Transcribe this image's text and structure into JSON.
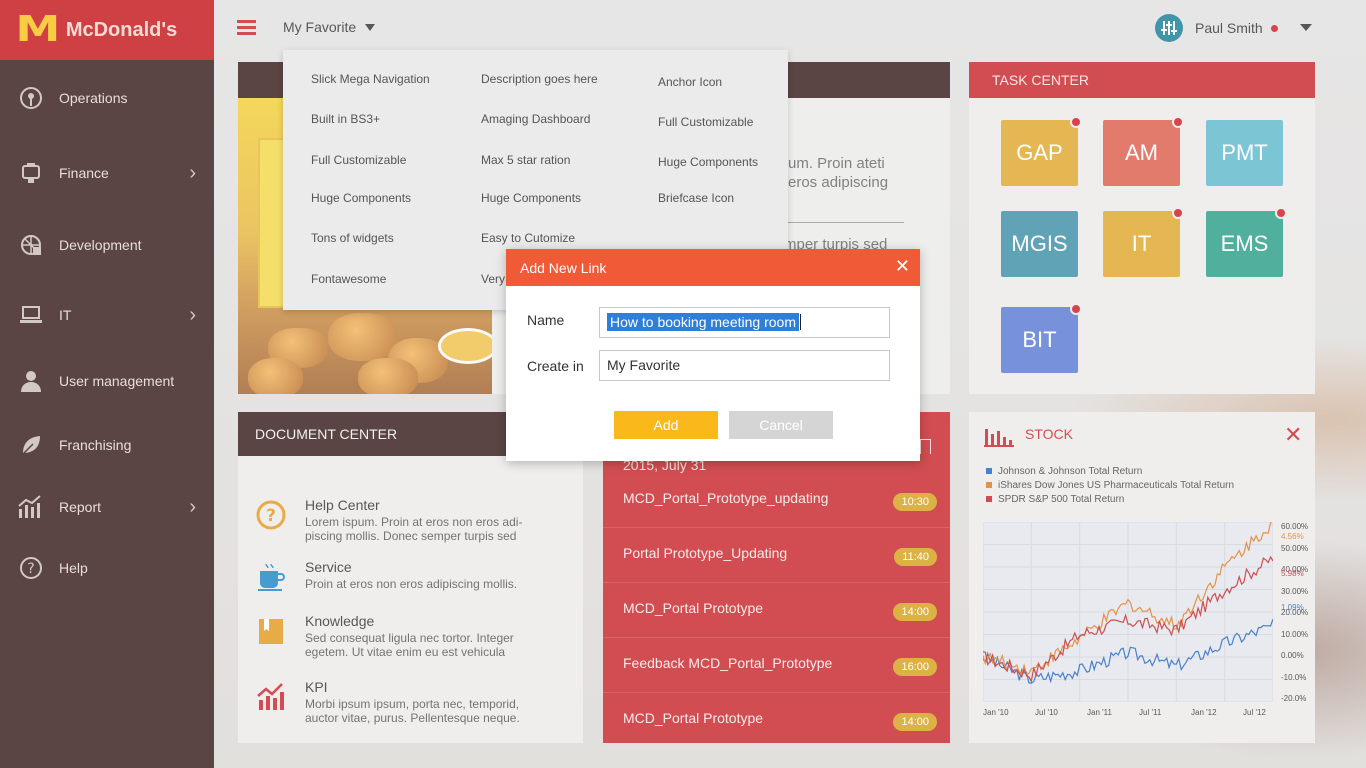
{
  "brand": {
    "logo_letter": "M",
    "name": "McDonald's"
  },
  "nav": [
    {
      "label": "Operations",
      "icon": "operations-icon",
      "has_children": false
    },
    {
      "label": "Finance",
      "icon": "finance-icon",
      "has_children": true
    },
    {
      "label": "Development",
      "icon": "development-icon",
      "has_children": false
    },
    {
      "label": "IT",
      "icon": "laptop-icon",
      "has_children": true
    },
    {
      "label": "User management",
      "icon": "user-icon",
      "has_children": false
    },
    {
      "label": "Franchising",
      "icon": "leaf-icon",
      "has_children": false
    },
    {
      "label": "Report",
      "icon": "report-icon",
      "has_children": true
    },
    {
      "label": "Help",
      "icon": "help-icon",
      "has_children": false
    }
  ],
  "topbar": {
    "favorite_label": "My Favorite",
    "user_name": "Paul Smith"
  },
  "dropdown": {
    "columns": [
      [
        "Slick Mega Navigation",
        "Built in BS3+",
        "Full Customizable",
        "Huge Components",
        "Tons of widgets",
        "Fontawesome"
      ],
      [
        "Description goes here",
        "Amaging Dashboard",
        "Max 5 star ration",
        "Huge Components",
        "Easy to Cutomize",
        "Very"
      ],
      [
        "Anchor Icon",
        "Full Customizable",
        "Huge Components",
        "Briefcase Icon"
      ]
    ]
  },
  "promo": {
    "text_line1": "um. Proin ateti",
    "text_line2": "eros adipiscing",
    "text_line3": "mper turpis sed"
  },
  "task_center": {
    "title": "TASK CENTER",
    "tiles": [
      {
        "label": "GAP",
        "color": "#dfa82e",
        "badge": true
      },
      {
        "label": "AM",
        "color": "#dc5e4c",
        "badge": true
      },
      {
        "label": "PMT",
        "color": "#5fb9cc",
        "badge": false
      },
      {
        "label": "MGIS",
        "color": "#3d8fa6",
        "badge": false
      },
      {
        "label": "IT",
        "color": "#dfa82e",
        "badge": true
      },
      {
        "label": "EMS",
        "color": "#2a9e88",
        "badge": true
      },
      {
        "label": "BIT",
        "color": "#5a79d2",
        "badge": true
      }
    ]
  },
  "document_center": {
    "title": "DOCUMENT CENTER",
    "items": [
      {
        "title": "Help Center",
        "desc": "Lorem ispum. Proin at eros non eros adi-\npiscing mollis. Donec semper turpis sed",
        "icon": "question-icon"
      },
      {
        "title": "Service",
        "desc": "Proin at eros non eros adipiscing mollis.",
        "icon": "coffee-cup-icon"
      },
      {
        "title": "Knowledge",
        "desc": "Sed consequat ligula nec tortor. Integer\negetem. Ut vitae enim eu est vehicula",
        "icon": "book-icon"
      },
      {
        "title": "KPI",
        "desc": "Morbi ipsum ipsum, porta nec, temporid,\nauctor vitae, purus. Pellentesque neque.",
        "icon": "kpi-chart-icon"
      }
    ]
  },
  "events": {
    "date": "2015, July 31",
    "items": [
      {
        "title": "MCD_Portal_Prototype_updating",
        "time": "10:30"
      },
      {
        "title": "Portal Prototype_Updating",
        "time": "11:40"
      },
      {
        "title": "MCD_Portal Prototype",
        "time": "14:00"
      },
      {
        "title": "Feedback MCD_Portal_Prototype",
        "time": "16:00"
      },
      {
        "title": "MCD_Portal Prototype",
        "time": "14:00"
      }
    ]
  },
  "stock": {
    "title": "STOCK",
    "close": "✕",
    "legend": [
      {
        "label": "Johnson & Johnson Total Return",
        "color": "#2066c0"
      },
      {
        "label": "iShares Dow Jones US Pharmaceuticals Total Return",
        "color": "#e07b20"
      },
      {
        "label": "SPDR S&P 500 Total Return",
        "color": "#c0282d"
      }
    ],
    "y_ticks": [
      "60.00%",
      "50.00%",
      "40.00%",
      "30.00%",
      "20.00%",
      "10.00%",
      "0.00%",
      "-10.0%",
      "-20.0%"
    ],
    "end_values": {
      "orange": "4.56%",
      "red": "5.98%",
      "blue": "1.09%"
    },
    "x_ticks": [
      "Jan '10",
      "Jul '10",
      "Jan '11",
      "Jul '11",
      "Jan '12",
      "Jul '12"
    ]
  },
  "chart_data": {
    "type": "line",
    "x": [
      "Jan '10",
      "Jul '10",
      "Jan '11",
      "Jul '11",
      "Jan '12",
      "Jul '12",
      "Dec '12"
    ],
    "ylim": [
      -20,
      60
    ],
    "series": [
      {
        "name": "Johnson & Johnson Total Return",
        "color": "#2066c0",
        "values": [
          0,
          -10,
          -6,
          2,
          -4,
          6,
          14
        ]
      },
      {
        "name": "iShares Dow Jones US Pharmaceuticals Total Return",
        "color": "#e07b20",
        "values": [
          0,
          -6,
          8,
          24,
          14,
          40,
          60
        ]
      },
      {
        "name": "SPDR S&P 500 Total Return",
        "color": "#c0282d",
        "values": [
          0,
          -8,
          10,
          16,
          12,
          30,
          44
        ]
      }
    ]
  },
  "modal": {
    "title": "Add New Link",
    "name_label": "Name",
    "name_value": "How to booking meeting room",
    "create_in_label": "Create in",
    "create_in_value": "My Favorite",
    "add_label": "Add",
    "cancel_label": "Cancel",
    "add_color": "#fbb81a",
    "cancel_color": "#d5d5d5"
  }
}
